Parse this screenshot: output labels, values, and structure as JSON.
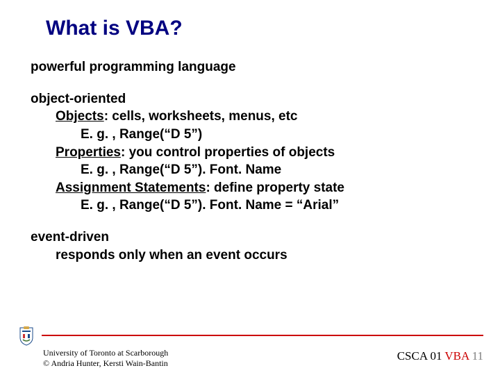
{
  "title": "What is VBA?",
  "section1": {
    "text": "powerful programming language"
  },
  "section2": {
    "header": "object-oriented",
    "l1a_label": "Objects",
    "l1a_rest": ": cells, worksheets, menus, etc",
    "l2a": "E. g. , Range(“D 5”)",
    "l1b_label": "Properties",
    "l1b_rest": ": you control properties of objects",
    "l2b": "E. g. , Range(“D 5”). Font. Name",
    "l1c_label": "Assignment Statements",
    "l1c_rest": ": define property state",
    "l2c": "E. g. , Range(“D 5”). Font. Name = “Arial”"
  },
  "section3": {
    "header": "event-driven",
    "l1": "responds only when an event occurs"
  },
  "footer": {
    "uni": "University of Toronto at Scarborough",
    "copyright": "© Andria Hunter, Kersti Wain-Bantin",
    "course": "CSCA 01",
    "vba": "VBA",
    "page": "11"
  }
}
